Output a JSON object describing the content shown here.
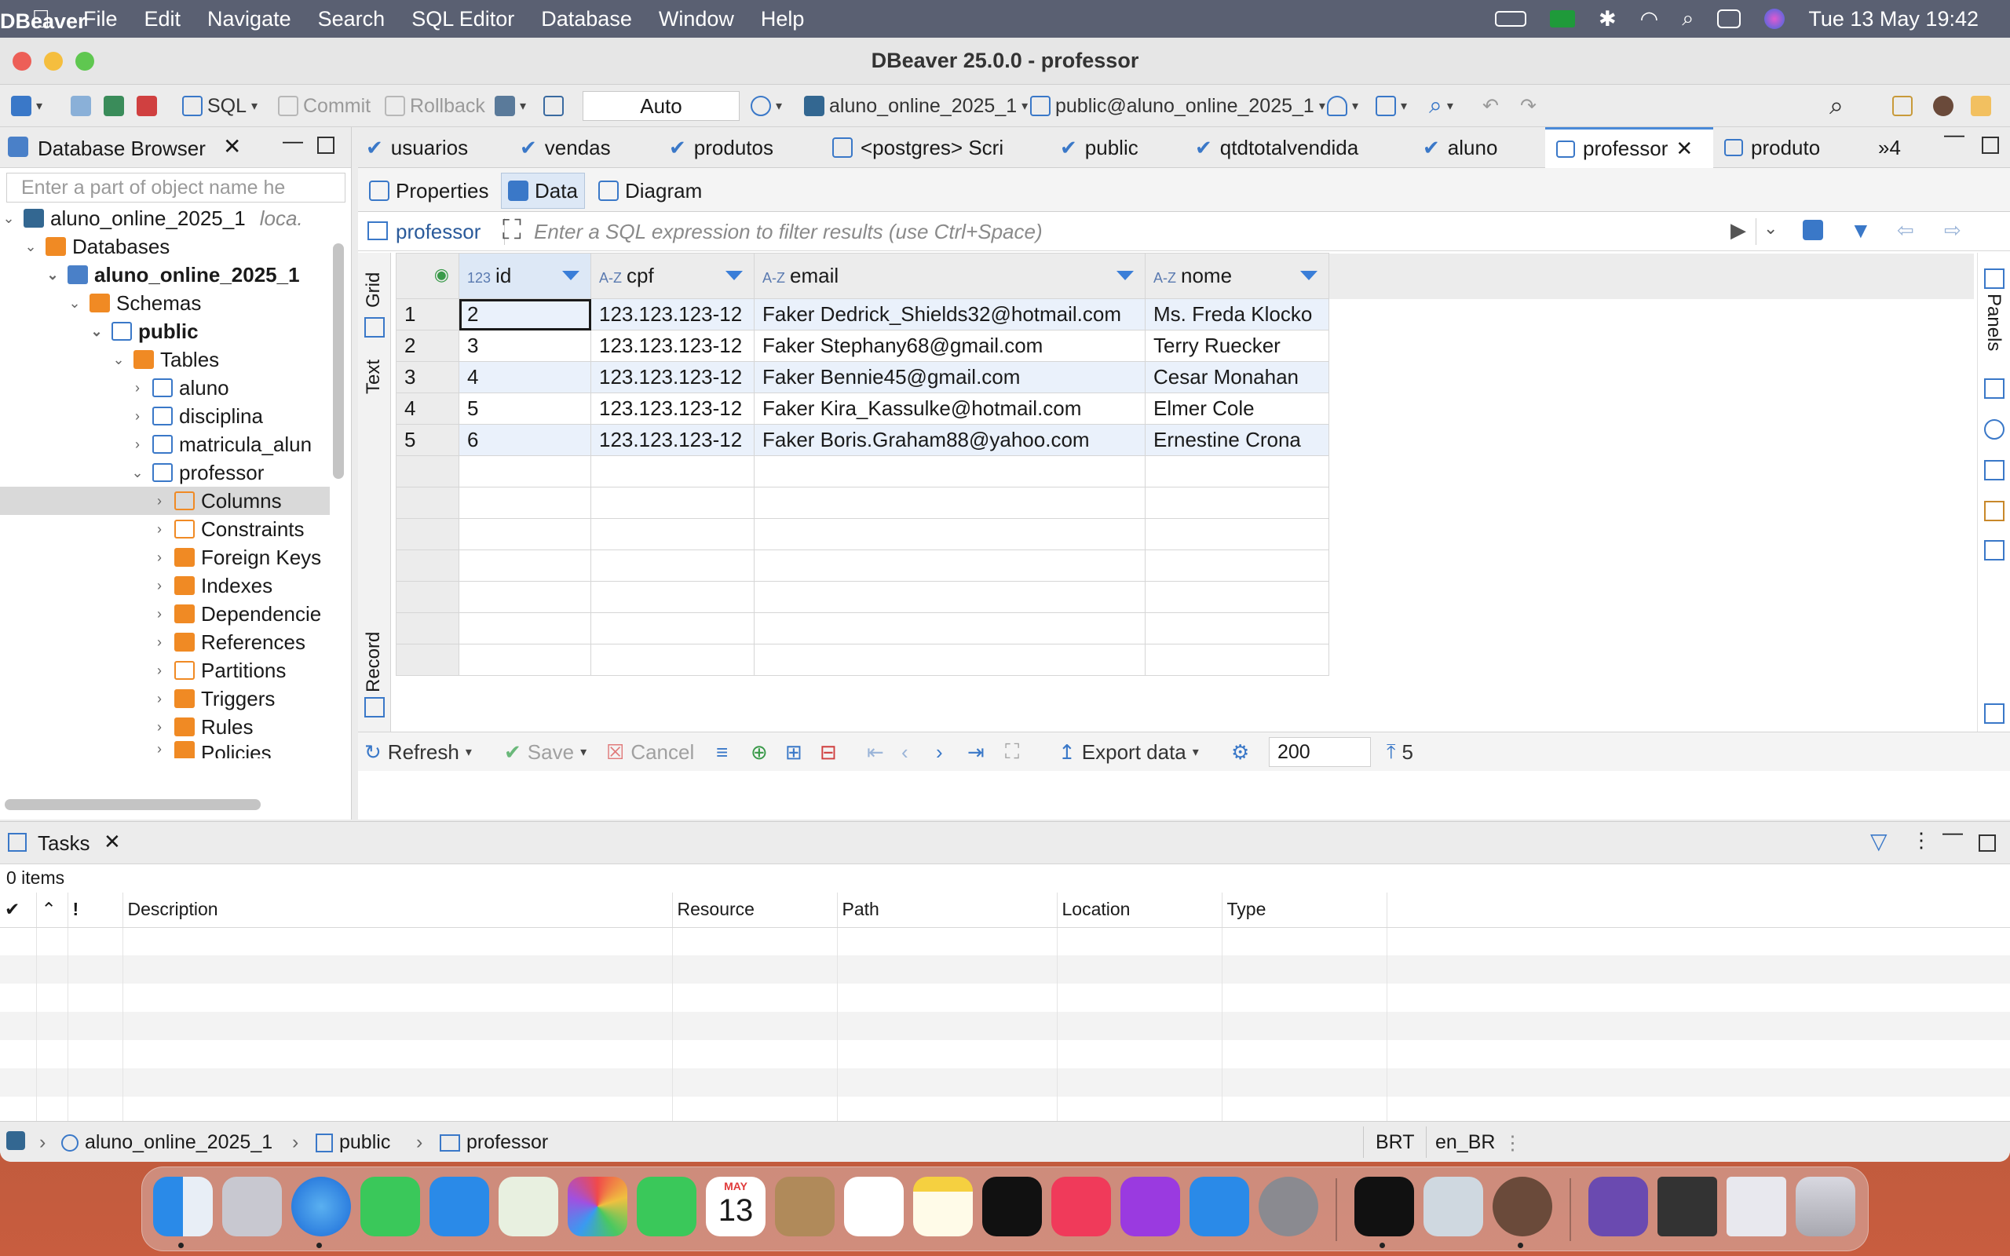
{
  "menubar": {
    "app_name": "DBeaver",
    "items": [
      "File",
      "Edit",
      "Navigate",
      "Search",
      "SQL Editor",
      "Database",
      "Window",
      "Help"
    ],
    "clock": "Tue 13 May  19:42"
  },
  "window": {
    "title": "DBeaver 25.0.0 - professor"
  },
  "toolbar": {
    "sql_label": "SQL",
    "commit_label": "Commit",
    "rollback_label": "Rollback",
    "transaction_mode": "Auto",
    "datasource_label": "aluno_online_2025_1",
    "schema_label": "public@aluno_online_2025_1"
  },
  "database_browser": {
    "title": "Database Browser",
    "search_placeholder": "Enter a part of object name he",
    "tree": [
      {
        "label": "aluno_online_2025_1",
        "suffix": "loca."
      },
      {
        "label": "Databases"
      },
      {
        "label": "aluno_online_2025_1"
      },
      {
        "label": "Schemas"
      },
      {
        "label": "public"
      },
      {
        "label": "Tables"
      },
      {
        "label": "aluno"
      },
      {
        "label": "disciplina"
      },
      {
        "label": "matricula_alun"
      },
      {
        "label": "professor"
      },
      {
        "label": "Columns"
      },
      {
        "label": "Constraints"
      },
      {
        "label": "Foreign Keys"
      },
      {
        "label": "Indexes"
      },
      {
        "label": "Dependencie"
      },
      {
        "label": "References"
      },
      {
        "label": "Partitions"
      },
      {
        "label": "Triggers"
      },
      {
        "label": "Rules"
      },
      {
        "label": "Policies"
      }
    ]
  },
  "editor_tabs": [
    "usuarios",
    "vendas",
    "produtos",
    "<postgres> Scri",
    "public",
    "qtdtotalvendida",
    "aluno",
    "professor",
    "produto"
  ],
  "editor_overflow": "»4",
  "sub_tabs": [
    "Properties",
    "Data",
    "Diagram"
  ],
  "filter": {
    "table_label": "professor",
    "placeholder": "Enter a SQL expression to filter results (use Ctrl+Space)"
  },
  "grid": {
    "side_tabs": [
      "Grid",
      "Text",
      "Record"
    ],
    "columns": [
      {
        "type": "123",
        "name": "id"
      },
      {
        "type": "A-Z",
        "name": "cpf"
      },
      {
        "type": "A-Z",
        "name": "email"
      },
      {
        "type": "A-Z",
        "name": "nome"
      }
    ],
    "rows": [
      {
        "n": "1",
        "id": "2",
        "cpf": "123.123.123-12",
        "email": "Faker Dedrick_Shields32@hotmail.com",
        "nome": "Ms. Freda Klocko"
      },
      {
        "n": "2",
        "id": "3",
        "cpf": "123.123.123-12",
        "email": "Faker Stephany68@gmail.com",
        "nome": "Terry Ruecker"
      },
      {
        "n": "3",
        "id": "4",
        "cpf": "123.123.123-12",
        "email": "Faker Bennie45@gmail.com",
        "nome": "Cesar Monahan"
      },
      {
        "n": "4",
        "id": "5",
        "cpf": "123.123.123-12",
        "email": "Faker Kira_Kassulke@hotmail.com",
        "nome": "Elmer Cole"
      },
      {
        "n": "5",
        "id": "6",
        "cpf": "123.123.123-12",
        "email": "Faker Boris.Graham88@yahoo.com",
        "nome": "Ernestine Crona"
      }
    ],
    "panels_label": "Panels"
  },
  "grid_footer": {
    "refresh": "Refresh",
    "save": "Save",
    "cancel": "Cancel",
    "export": "Export data",
    "fetch_size": "200",
    "row_count": "5"
  },
  "tasks": {
    "title": "Tasks",
    "count": "0 items",
    "columns": [
      "!",
      "Description",
      "Resource",
      "Path",
      "Location",
      "Type"
    ]
  },
  "statusbar": {
    "breadcrumb": [
      "aluno_online_2025_1",
      "public",
      "professor"
    ],
    "timezone": "BRT",
    "locale": "en_BR"
  },
  "dock": {
    "calendar_month": "MAY",
    "calendar_day": "13"
  }
}
